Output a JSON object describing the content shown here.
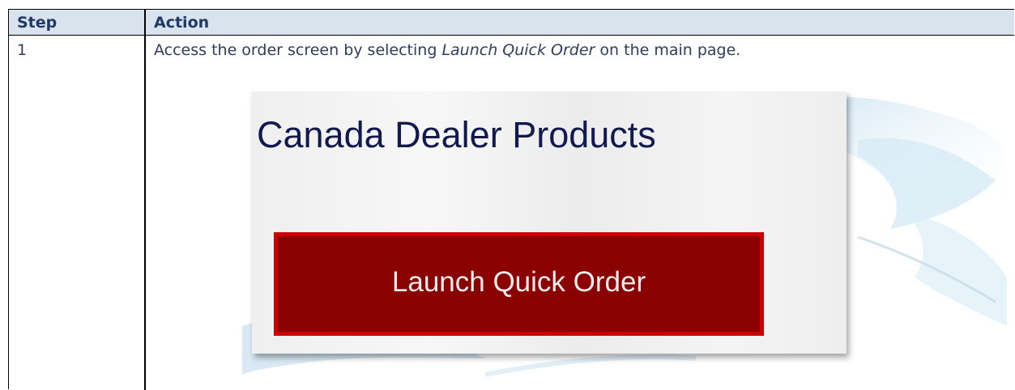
{
  "table": {
    "header": {
      "step": "Step",
      "action": "Action"
    },
    "rows": [
      {
        "step": "1",
        "action_before": "Access the order screen by selecting ",
        "action_emphasis": "Launch Quick Order",
        "action_after": " on the main page."
      }
    ]
  },
  "screenshot": {
    "title": "Canada Dealer Products",
    "button_label": "Launch Quick Order"
  },
  "colors": {
    "header_bg": "#d9e3ee",
    "header_text": "#1f3864",
    "button_bg": "#8b0000",
    "button_border": "#cc0000",
    "title_text": "#11194f"
  }
}
